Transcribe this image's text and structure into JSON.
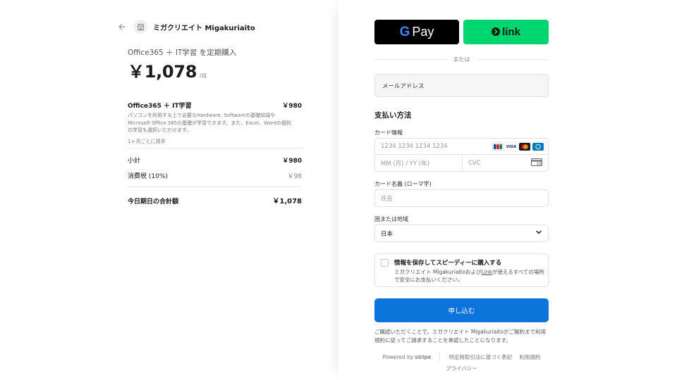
{
  "merchant": {
    "name": "ミガクリエイト Migakuriaito",
    "back_icon": "arrow-left-icon",
    "store_icon": "store-icon"
  },
  "summary": {
    "heading": "Office365 ＋ IT学習 を定期購入",
    "price": "￥1,078",
    "price_unit": "/月"
  },
  "line_item": {
    "name": "Office365 ＋ IT学習",
    "price": "￥980",
    "description": "パソコンを利用する上で必要なHardware, Softwareの基礎知識やMicrosoft Office 365の基礎が学習できます。また、Excel、Wordの個別の学習も選択いただけます。",
    "billing": "1ヶ月ごとに請求"
  },
  "totals": {
    "subtotal_label": "小計",
    "subtotal_value": "￥980",
    "tax_label": "消費税 (10%)",
    "tax_value": "￥98",
    "total_label": "今日期日の合計額",
    "total_value": "￥1,078"
  },
  "payment": {
    "gpay_label": "Pay",
    "link_label": "link",
    "or_text": "または",
    "email_placeholder": "メールアドレス",
    "method_title": "支払い方法",
    "card_info_label": "カード情報",
    "card_number_placeholder": "1234 1234 1234 1234",
    "expiry_placeholder": "MM (月) / YY (年)",
    "cvc_placeholder": "CVC",
    "card_brands": [
      "JCB",
      "VISA",
      "Mastercard",
      "Diners"
    ],
    "cardholder_label": "カード名義 (ローマ字)",
    "cardholder_placeholder": "氏名",
    "country_label": "国または地域",
    "country_value": "日本",
    "save_title": "情報を保存してスピーディーに購入する",
    "save_desc_pre": "ミガクリエイト Migakuriaitoおよび",
    "save_desc_link": "Link",
    "save_desc_post": "が使えるすべての場所で安全にお支払いください。",
    "submit_label": "申し込む",
    "terms": "ご購読いただくことで、ミガクリエイト Migakuriaitoがご解約まで利用規約に従ってご請求することを承認したことになります。"
  },
  "footer": {
    "powered_by": "Powered by",
    "stripe": "stripe",
    "links": [
      "特定商取引法に基づく表記",
      "利用規約"
    ],
    "privacy": "プライバシー"
  },
  "colors": {
    "submit": "#0a74da",
    "link_green": "#00d66f",
    "gpay_black": "#000000"
  }
}
